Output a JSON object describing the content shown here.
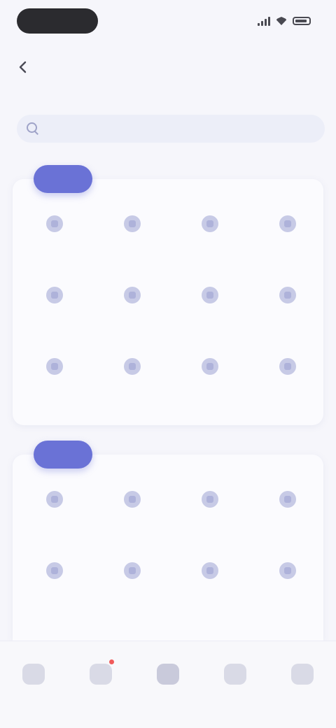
{
  "status_bar": {
    "time": "",
    "accent": "#2b2b2f"
  },
  "nav": {
    "title": "",
    "back_icon": "chevron-left-icon"
  },
  "search": {
    "placeholder": "",
    "value": ""
  },
  "sections": [
    {
      "title": "",
      "more_label": "",
      "items": [
        {
          "label": "",
          "icon": "app-icon"
        },
        {
          "label": "",
          "icon": "app-icon"
        },
        {
          "label": "",
          "icon": "app-icon"
        },
        {
          "label": "",
          "icon": "app-icon"
        },
        {
          "label": "",
          "icon": "app-icon"
        },
        {
          "label": "",
          "icon": "app-icon"
        },
        {
          "label": "",
          "icon": "app-icon"
        },
        {
          "label": "",
          "icon": "app-icon"
        },
        {
          "label": "",
          "icon": "app-icon"
        },
        {
          "label": "",
          "icon": "app-icon"
        },
        {
          "label": "",
          "icon": "app-icon"
        },
        {
          "label": "",
          "icon": "app-icon"
        }
      ]
    },
    {
      "title": "",
      "more_label": "",
      "items": [
        {
          "label": "",
          "icon": "app-icon"
        },
        {
          "label": "",
          "icon": "app-icon"
        },
        {
          "label": "",
          "icon": "app-icon"
        },
        {
          "label": "",
          "icon": "app-icon"
        },
        {
          "label": "",
          "icon": "app-icon"
        },
        {
          "label": "",
          "icon": "app-icon"
        },
        {
          "label": "",
          "icon": "app-icon"
        },
        {
          "label": "",
          "icon": "app-icon"
        }
      ]
    }
  ],
  "tabbar": {
    "tabs": [
      {
        "label": "",
        "icon": "home-icon"
      },
      {
        "label": "",
        "icon": "message-icon",
        "badge": true
      },
      {
        "label": "",
        "icon": "apps-icon"
      },
      {
        "label": "",
        "icon": "contacts-icon"
      },
      {
        "label": "",
        "icon": "profile-icon"
      }
    ]
  },
  "colors": {
    "accent": "#6a72d6",
    "background": "#f6f6fb",
    "badge": "#f05a5a"
  }
}
